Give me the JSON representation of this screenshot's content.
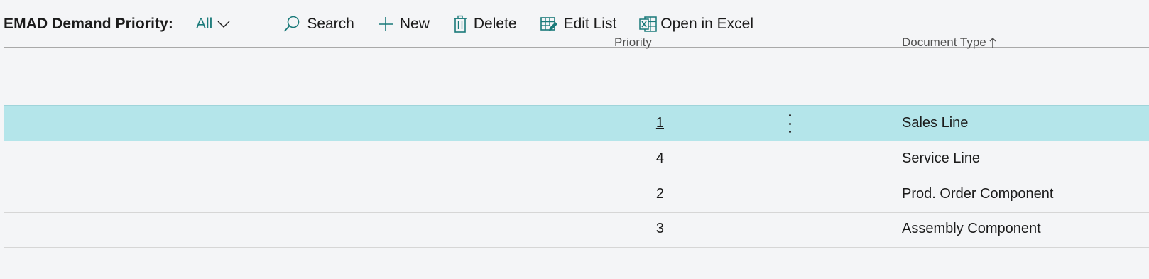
{
  "page": {
    "caption": "EMAD Demand Priority:",
    "filter_label": "All"
  },
  "actions": {
    "search": "Search",
    "new": "New",
    "delete": "Delete",
    "edit_list": "Edit List",
    "open_in_excel": "Open in Excel"
  },
  "columns": {
    "priority": "Priority",
    "document_type": "Document Type"
  },
  "rows": [
    {
      "priority": "1",
      "document_type": "Sales Line",
      "selected": true
    },
    {
      "priority": "4",
      "document_type": "Service Line",
      "selected": false
    },
    {
      "priority": "2",
      "document_type": "Prod. Order Component",
      "selected": false
    },
    {
      "priority": "3",
      "document_type": "Assembly Component",
      "selected": false
    }
  ],
  "colors": {
    "accent": "#1a7a7a",
    "selected_row": "#b4e5ea",
    "background": "#f4f5f7"
  },
  "icons": {
    "filter": "chevron-down-icon",
    "search": "search-icon",
    "new": "plus-icon",
    "delete": "trash-icon",
    "edit_list": "edit-list-icon",
    "open_in_excel": "excel-icon",
    "sort": "sort-ascending-icon",
    "row_menu": "more-vertical-icon"
  }
}
